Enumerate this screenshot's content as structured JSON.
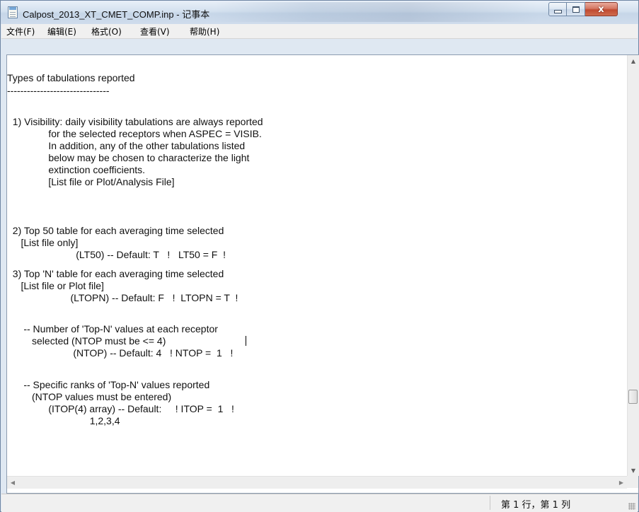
{
  "window": {
    "title": "Calpost_2013_XT_CMET_COMP.inp - 记事本",
    "controls": {
      "minimize": "minimize",
      "maximize": "maximize",
      "close": "x"
    }
  },
  "menu": [
    "文件(F)",
    "编辑(E)",
    "格式(O)",
    "查看(V)",
    "帮助(H)"
  ],
  "document": {
    "lines": [
      "Types of tabulations reported",
      "-------------------------------",
      "  1) Visibility: daily visibility tabulations are always reported",
      "               for the selected receptors when ASPEC = VISIB.",
      "               In addition, any of the other tabulations listed",
      "               below may be chosen to characterize the light",
      "               extinction coefficients.",
      "               [List file or Plot/Analysis File]",
      "  2) Top 50 table for each averaging time selected",
      "     [List file only]",
      "                         (LT50) -- Default: T   !   LT50 = F  !",
      "  3) Top 'N' table for each averaging time selected",
      "     [List file or Plot file]",
      "                       (LTOPN) -- Default: F   !  LTOPN = T  !",
      "      -- Number of 'Top-N' values at each receptor",
      "         selected (NTOP must be <= 4)",
      "                        (NTOP) -- Default: 4   ! NTOP =  1   !",
      "      -- Specific ranks of 'Top-N' values reported",
      "         (NTOP values must be entered)",
      "               (ITOP(4) array) -- Default:     ! ITOP =  1   !",
      "                              1,2,3,4"
    ]
  },
  "status": {
    "position": "第 1 行，第 1 列"
  }
}
